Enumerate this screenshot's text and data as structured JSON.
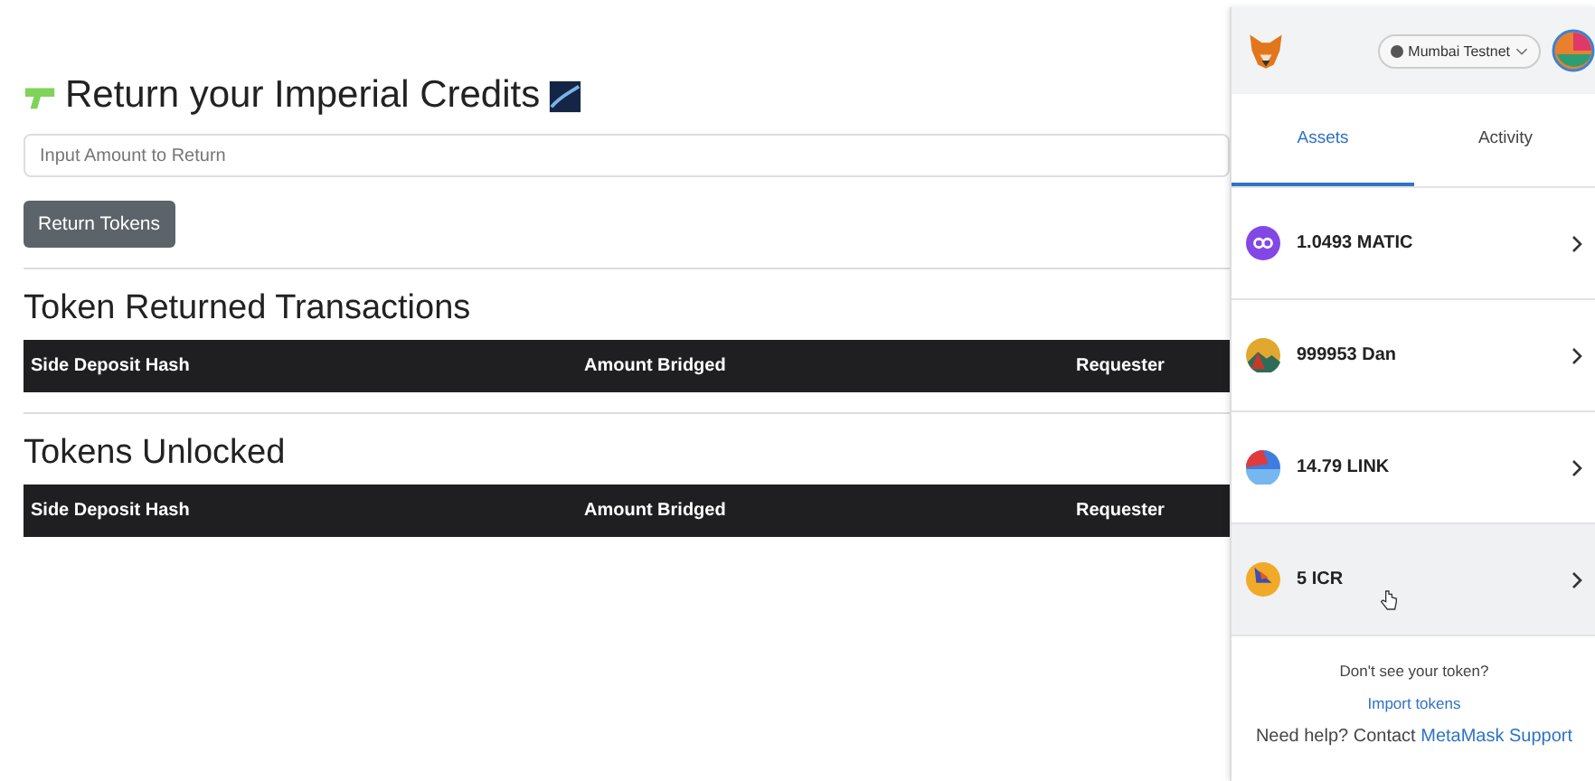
{
  "page": {
    "title": "Return your Imperial Credits",
    "amount_input": {
      "placeholder": "Input Amount to Return"
    },
    "return_button": "Return Tokens",
    "tables": [
      {
        "title": "Token Returned Transactions",
        "columns": [
          "Side Deposit Hash",
          "Amount Bridged",
          "Requester"
        ]
      },
      {
        "title": "Tokens Unlocked",
        "columns": [
          "Side Deposit Hash",
          "Amount Bridged",
          "Requester"
        ]
      }
    ]
  },
  "wallet": {
    "network": "Mumbai Testnet",
    "tabs": [
      {
        "label": "Assets",
        "selected": true
      },
      {
        "label": "Activity",
        "selected": false
      }
    ],
    "assets": [
      {
        "label": "1.0493 MATIC",
        "kind": "matic",
        "hovered": false
      },
      {
        "label": "999953 Dan",
        "kind": "mountain",
        "hovered": false
      },
      {
        "label": "14.79 LINK",
        "kind": "split",
        "hovered": false
      },
      {
        "label": "5 ICR",
        "kind": "sail",
        "hovered": true
      }
    ],
    "missing_prompt": "Don't see your token?",
    "import_link": "Import tokens",
    "help_text": "Need help? Contact ",
    "support_link": "MetaMask Support"
  }
}
